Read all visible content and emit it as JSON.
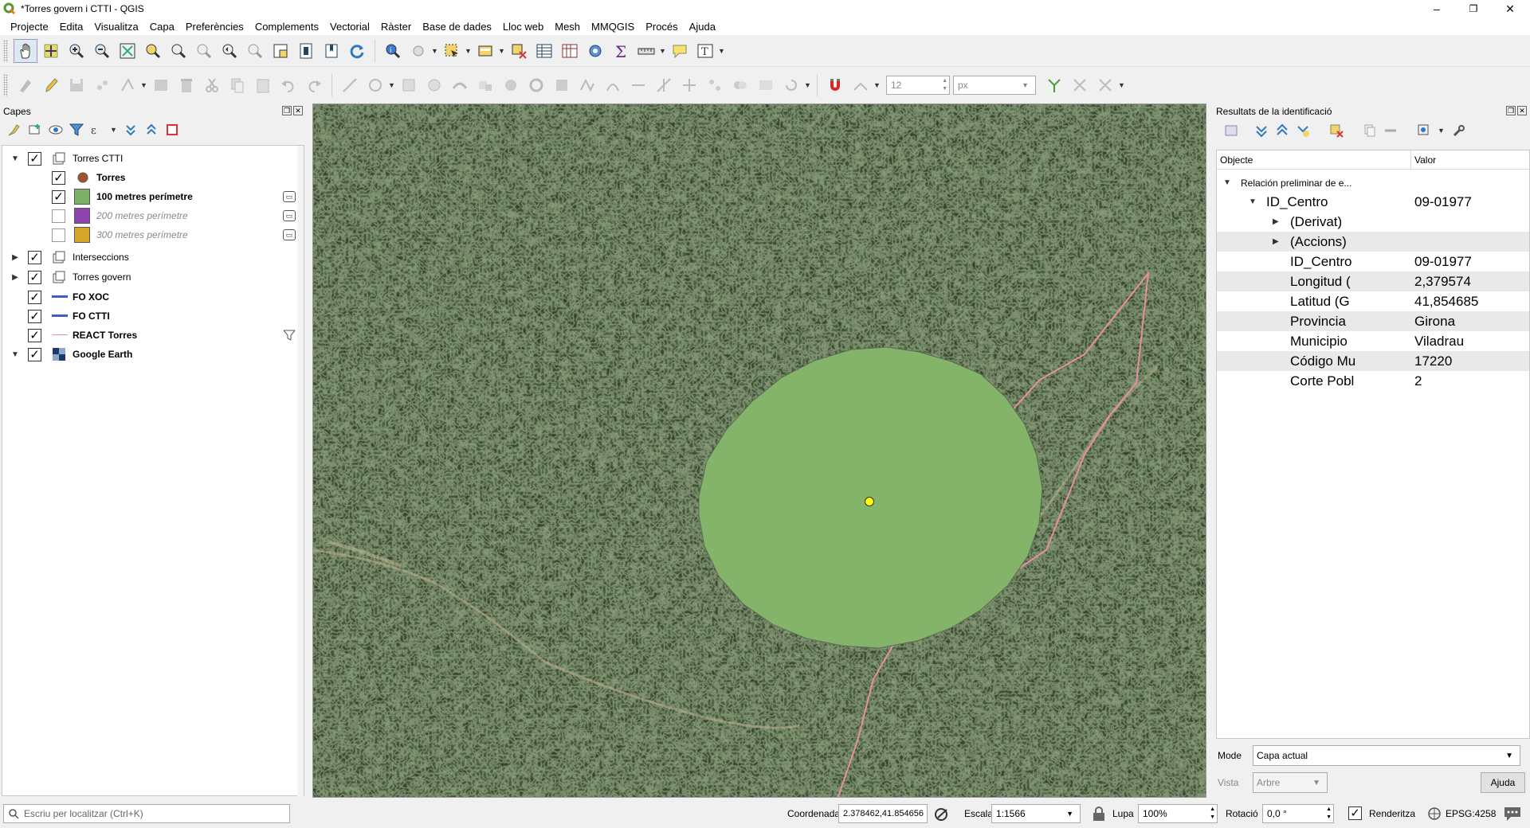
{
  "window": {
    "title": "*Torres govern i CTTI - QGIS",
    "minimize": "–",
    "maximize": "❐",
    "close": "✕"
  },
  "menu": [
    "Projecte",
    "Edita",
    "Visualitza",
    "Capa",
    "Preferències",
    "Complements",
    "Vectorial",
    "Ràster",
    "Base de dades",
    "Lloc web",
    "Mesh",
    "MMQGIS",
    "Procés",
    "Ajuda"
  ],
  "snapping": {
    "tolerance": "12",
    "unit": "px"
  },
  "layers_panel": {
    "title": "Capes",
    "items": [
      {
        "name": "Torres CTTI",
        "checked": true,
        "expanded": true,
        "type": "group"
      },
      {
        "name": "Torres",
        "checked": true,
        "type": "point",
        "color": "#a0522d"
      },
      {
        "name": "100 metres perímetre",
        "checked": true,
        "type": "polygon",
        "color": "#7fb069"
      },
      {
        "name": "200 metres perímetre",
        "checked": false,
        "type": "polygon",
        "color": "#8e44ad"
      },
      {
        "name": "300 metres perímetre",
        "checked": false,
        "type": "polygon",
        "color": "#d4a72c"
      },
      {
        "name": "Interseccions",
        "checked": true,
        "expanded": false,
        "type": "group"
      },
      {
        "name": "Torres govern",
        "checked": true,
        "expanded": false,
        "type": "group"
      },
      {
        "name": "FO XOC",
        "checked": true,
        "type": "line",
        "color": "#3a5fcd"
      },
      {
        "name": "FO CTTI",
        "checked": true,
        "type": "line",
        "color": "#3a5fcd"
      },
      {
        "name": "REACT Torres",
        "checked": true,
        "type": "line",
        "color": "#e88fa0"
      },
      {
        "name": "Google Earth",
        "checked": true,
        "expanded": true,
        "type": "raster"
      }
    ]
  },
  "identify_panel": {
    "title": "Resultats de la identificació",
    "col_object": "Objecte",
    "col_value": "Valor",
    "layer_node": "Relación preliminar de e...",
    "feature": {
      "key": "ID_Centro",
      "value": "09-01977"
    },
    "derived": "(Derivat)",
    "actions": "(Accions)",
    "attributes": [
      {
        "key": "ID_Centro",
        "value": "09-01977"
      },
      {
        "key": "Longitud (",
        "value": "2,379574"
      },
      {
        "key": "Latitud (G",
        "value": "41,854685"
      },
      {
        "key": "Provincia",
        "value": "Girona"
      },
      {
        "key": "Municipio",
        "value": "Viladrau"
      },
      {
        "key": "Código Mu",
        "value": "17220"
      },
      {
        "key": "Corte Pobl",
        "value": "2"
      }
    ],
    "mode_label": "Mode",
    "mode_value": "Capa actual",
    "view_label": "Vista",
    "view_value": "Arbre",
    "help_button": "Ajuda"
  },
  "statusbar": {
    "locator_placeholder": "Escriu per localitzar (Ctrl+K)",
    "coord_label": "Coordenada",
    "coord_value": "2.378462,41.854656",
    "scale_label": "Escala",
    "scale_value": "1:1566",
    "magnifier_label": "Lupa",
    "magnifier_value": "100%",
    "rotation_label": "Rotació",
    "rotation_value": "0,0 °",
    "render_label": "Renderitza",
    "crs": "EPSG:4258"
  },
  "colors": {
    "buffer_fill": "#84b36a",
    "tower_point": "#ffff00",
    "react_line": "#e88fa0",
    "forest": "#2d3b24"
  }
}
